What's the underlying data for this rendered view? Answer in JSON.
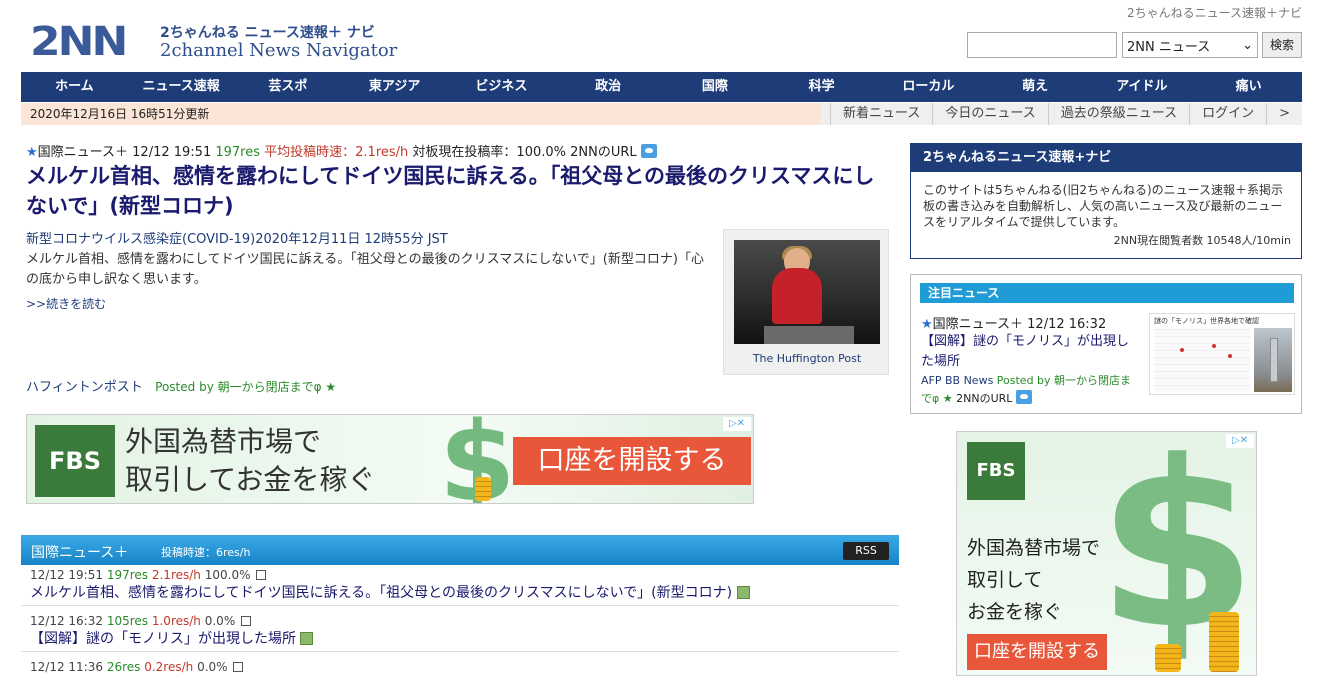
{
  "header": {
    "logo_mark": "2NN",
    "logo_jp": "2ちゃんねる ニュース速報＋ ナビ",
    "logo_en": "2channel News Navigator",
    "tagline": "2ちゃんねるニュース速報＋ナビ",
    "search_select": "2NN ニュース",
    "search_button": "検索"
  },
  "nav": [
    "ホーム",
    "ニュース速報",
    "芸スポ",
    "東アジア",
    "ビジネス",
    "政治",
    "国際",
    "科学",
    "ローカル",
    "萌え",
    "アイドル",
    "痛い"
  ],
  "subbar": {
    "updated": "2020年12月16日 16時51分更新",
    "links": [
      "新着ニュース",
      "今日のニュース",
      "過去の祭級ニュース",
      "ログイン",
      ">"
    ]
  },
  "top_story": {
    "category": "国際ニュース＋",
    "datetime": "12/12 19:51",
    "res": "197res",
    "avg_rate": "平均投稿時速：2.1res/h",
    "board_rate": "対板現在投稿率：100.0%",
    "url_label": "2NNのURL",
    "headline": "メルケル首相、感情を露わにしてドイツ国民に訴える。「祖父母との最後のクリスマスにしないで」(新型コロナ)",
    "article_date": "新型コロナウイルス感染症(COVID-19)2020年12月11日 12時55分 JST",
    "article_body": "メルケル首相、感情を露わにしてドイツ国民に訴える。「祖父母との最後のクリスマスにしないで」(新型コロナ)「心の底から申し訳なく思います。",
    "read_more": ">>続きを読む",
    "thumb_caption": "The Huffington Post",
    "source": "ハフィントンポスト",
    "posted_by": "Posted by 朝一から閉店までφ ★"
  },
  "ad_banner": {
    "logo": "FBS",
    "line1": "外国為替市場で",
    "line2": "取引してお金を稼ぐ",
    "cta": "口座を開設する",
    "dollar": "$"
  },
  "feed": {
    "title": "国際ニュース＋",
    "rate": "投稿時速：6res/h",
    "rss": "RSS",
    "items": [
      {
        "datetime": "12/12 19:51",
        "res": "197res",
        "rate": "2.1res/h",
        "pct": "100.0%",
        "title": "メルケル首相、感情を露わにしてドイツ国民に訴える。「祖父母との最後のクリスマスにしないで」(新型コロナ)"
      },
      {
        "datetime": "12/12 16:32",
        "res": "105res",
        "rate": "1.0res/h",
        "pct": "0.0%",
        "title": "【図解】謎の「モノリス」が出現した場所"
      },
      {
        "datetime": "12/12 11:36",
        "res": "26res",
        "rate": "0.2res/h",
        "pct": "0.0%",
        "title": ""
      }
    ]
  },
  "about": {
    "title": "2ちゃんねるニュース速報+ナビ",
    "body": "このサイトは5ちゃんねる(旧2ちゃんねる)のニュース速報＋系掲示板の書き込みを自動解析し、人気の高いニュース及び最新のニュースをリアルタイムで提供しています。",
    "stat": "2NN現在閲覧者数 10548人/10min"
  },
  "featured": {
    "heading": "注目ニュース",
    "category": "国際ニュース＋",
    "datetime": "12/12 16:32",
    "title": "【図解】謎の「モノリス」が出現した場所",
    "source": "AFP BB News",
    "posted_by": "Posted by 朝一から閉店までφ ★",
    "url_label": "2NNのURL",
    "image_caption": "謎の「モノリス」世界各地で確認"
  },
  "ad_side": {
    "logo": "FBS",
    "line1": "外国為替市場で",
    "line2": "取引して",
    "line3": "お金を稼ぐ",
    "cta": "口座を開設する",
    "dollar": "$"
  },
  "colors": {
    "nav_bg": "#1e3c78",
    "feed_header": "#1784c8",
    "cta": "#e8573a",
    "brand_green": "#3a7a3a"
  }
}
